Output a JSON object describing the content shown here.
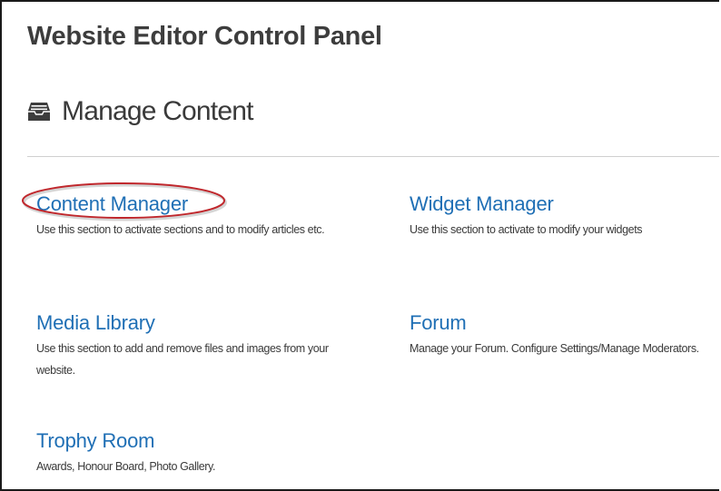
{
  "panel": {
    "title": "Website Editor Control Panel"
  },
  "section": {
    "icon": "inbox-icon",
    "title": "Manage Content"
  },
  "items": [
    {
      "label": "Content Manager",
      "description": "Use this section to activate sections and to modify articles etc."
    },
    {
      "label": "Widget Manager",
      "description": "Use this section to activate to modify your widgets"
    },
    {
      "label": "Media Library",
      "description": "Use this section to add and remove files and images from your website."
    },
    {
      "label": "Forum",
      "description": "Manage your Forum. Configure Settings/Manage Moderators."
    },
    {
      "label": "Trophy Room",
      "description": "Awards, Honour Board, Photo Gallery."
    }
  ],
  "colors": {
    "link": "#1f6fb5",
    "highlight_ring": "#c0282d",
    "text": "#3a3a3a"
  }
}
